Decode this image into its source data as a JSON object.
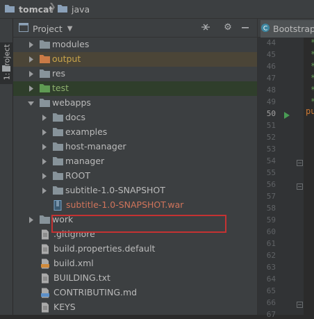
{
  "breadcrumb": [
    {
      "label": "tomcat",
      "bold": true
    },
    {
      "label": "java",
      "bold": false
    }
  ],
  "tool_window_tab": "1: Project",
  "panel": {
    "title": "Project",
    "header_icons": [
      "collapse-icon",
      "gear-icon",
      "hide-icon"
    ]
  },
  "tree": [
    {
      "label": "modules",
      "type": "folder",
      "expanded": false,
      "indent": 0
    },
    {
      "label": "output",
      "type": "folder-excluded",
      "expanded": false,
      "indent": 0,
      "style": "output"
    },
    {
      "label": "res",
      "type": "folder",
      "expanded": false,
      "indent": 0
    },
    {
      "label": "test",
      "type": "folder-test",
      "expanded": false,
      "indent": 0,
      "style": "test"
    },
    {
      "label": "webapps",
      "type": "folder",
      "expanded": true,
      "indent": 0
    },
    {
      "label": "docs",
      "type": "folder",
      "expanded": false,
      "indent": 1
    },
    {
      "label": "examples",
      "type": "folder",
      "expanded": false,
      "indent": 1
    },
    {
      "label": "host-manager",
      "type": "folder",
      "expanded": false,
      "indent": 1
    },
    {
      "label": "manager",
      "type": "folder",
      "expanded": false,
      "indent": 1
    },
    {
      "label": "ROOT",
      "type": "folder",
      "expanded": false,
      "indent": 1
    },
    {
      "label": "subtitle-1.0-SNAPSHOT",
      "type": "folder",
      "expanded": false,
      "indent": 1
    },
    {
      "label": "subtitle-1.0-SNAPSHOT.war",
      "type": "war-file",
      "expanded": null,
      "indent": 1,
      "style": "war"
    },
    {
      "label": "work",
      "type": "folder",
      "expanded": false,
      "indent": 0
    },
    {
      "label": ".gitignore",
      "type": "file",
      "expanded": null,
      "indent": 0
    },
    {
      "label": "build.properties.default",
      "type": "file",
      "expanded": null,
      "indent": 0
    },
    {
      "label": "build.xml",
      "type": "xml-file",
      "expanded": null,
      "indent": 0
    },
    {
      "label": "BUILDING.txt",
      "type": "file",
      "expanded": null,
      "indent": 0
    },
    {
      "label": "CONTRIBUTING.md",
      "type": "md-file",
      "expanded": null,
      "indent": 0
    },
    {
      "label": "KEYS",
      "type": "file",
      "expanded": null,
      "indent": 0
    }
  ],
  "editor": {
    "tab_label": "Bootstrap",
    "line_numbers": [
      "44",
      "45",
      "46",
      "47",
      "48",
      "49",
      "50",
      "51",
      "52",
      "53",
      "54",
      "55",
      "56",
      "57",
      "58",
      "59",
      "60",
      "61",
      "62",
      "63",
      "64",
      "65",
      "66",
      "67"
    ],
    "current_line": "50",
    "code_fragment": "pu",
    "comment_marker": "*"
  },
  "colors": {
    "accent_selection": "#c53232",
    "output_folder": "#c9a54b",
    "test_folder": "#8fb16f",
    "war_file": "#d0745b"
  }
}
